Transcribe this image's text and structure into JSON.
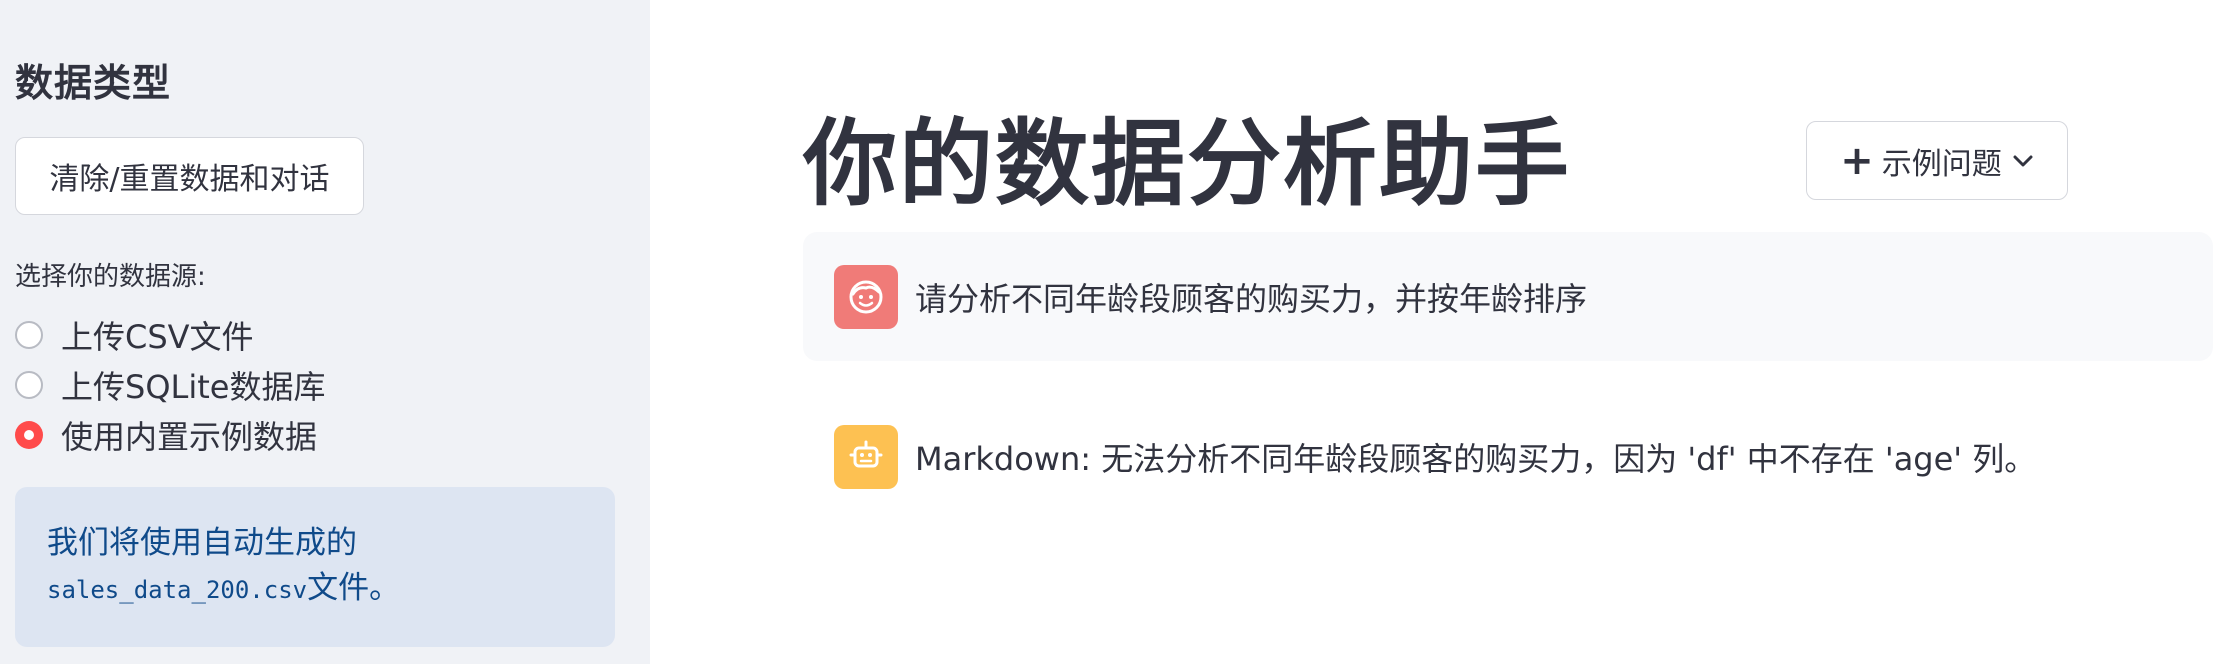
{
  "sidebar": {
    "title": "数据类型",
    "reset_button_label": "清除/重置数据和对话",
    "radio_group_label": "选择你的数据源:",
    "options": [
      {
        "label": "上传CSV文件",
        "selected": false
      },
      {
        "label": "上传SQLite数据库",
        "selected": false
      },
      {
        "label": "使用内置示例数据",
        "selected": true
      }
    ],
    "info": {
      "line1": "我们将使用自动生成的",
      "filename": "sales_data_200.csv",
      "line2_suffix": "文件。"
    }
  },
  "main": {
    "title": "你的数据分析助手",
    "example_button_label": "示例问题",
    "messages": [
      {
        "role": "user",
        "avatar": "user-face-icon",
        "text": "请分析不同年龄段顾客的购买力，并按年龄排序"
      },
      {
        "role": "assistant",
        "avatar": "robot-icon",
        "text": "Markdown: 无法分析不同年龄段顾客的购买力，因为 'df' 中不存在 'age' 列。"
      }
    ]
  },
  "colors": {
    "sidebar_bg": "#f0f2f6",
    "accent_red": "#ff4b4b",
    "user_avatar": "#f07b78",
    "bot_avatar": "#fdc152",
    "info_bg": "#dde5f2",
    "info_text": "#0f4a8a"
  }
}
